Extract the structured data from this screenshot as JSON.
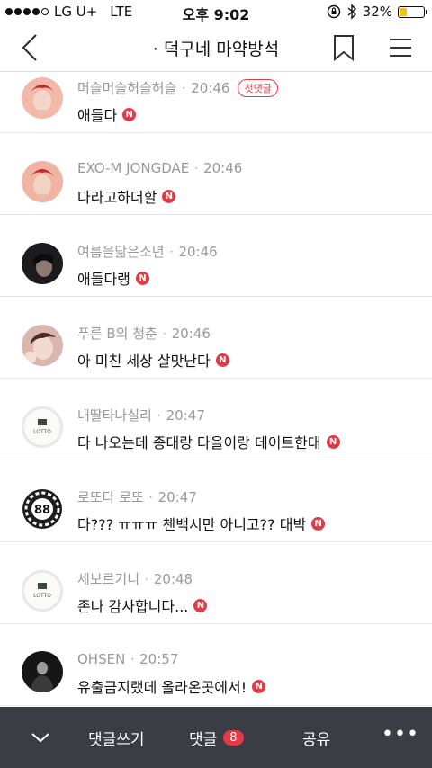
{
  "status_bar": {
    "carrier": "LG U+",
    "network": "LTE",
    "time": "오후 9:02",
    "battery_percent": "32%",
    "battery_level": 0.32
  },
  "header": {
    "title": "· 덕구네 마약방석",
    "icons": {
      "back": "back-chevron-icon",
      "bookmark": "bookmark-icon",
      "menu": "hamburger-menu-icon"
    }
  },
  "comments": [
    {
      "author": "머슬머슬허슬허슬",
      "time": "20:46",
      "text": "애들다",
      "badge": "첫댓글"
    },
    {
      "author": "EXO-M JONGDAE",
      "time": "20:46",
      "text": "다라고하더할"
    },
    {
      "author": "여름을닮은소년",
      "time": "20:46",
      "text": "애들다랭"
    },
    {
      "author": "푸른 B의 청춘",
      "time": "20:46",
      "text": "아 미친 세상 살맛난다"
    },
    {
      "author": "내딸타나실리",
      "time": "20:47",
      "text": "다 나오는데 종대랑 다을이랑 데이트한대",
      "avatar_text": "LOTTO"
    },
    {
      "author": "로또다 로또",
      "time": "20:47",
      "text": "다??? ㅠㅠㅠ 첸백시만 아니고?? 대박",
      "avatar_text": "88"
    },
    {
      "author": "세보르기니",
      "time": "20:48",
      "text": "존나 감사합니다...",
      "avatar_text": "LOTTO"
    },
    {
      "author": "OHSEN",
      "time": "20:57",
      "text": "유출금지랬데 올라온곳에서!"
    }
  ],
  "new_badge_label": "N",
  "bottom_bar": {
    "write_label": "댓글쓰기",
    "comments_label": "댓글",
    "comments_count": "8",
    "share_label": "공유",
    "more_label": "•••"
  },
  "colors": {
    "accent": "#e63946",
    "bottom_bar": "#3a3d44",
    "battery": "#f5c400"
  }
}
